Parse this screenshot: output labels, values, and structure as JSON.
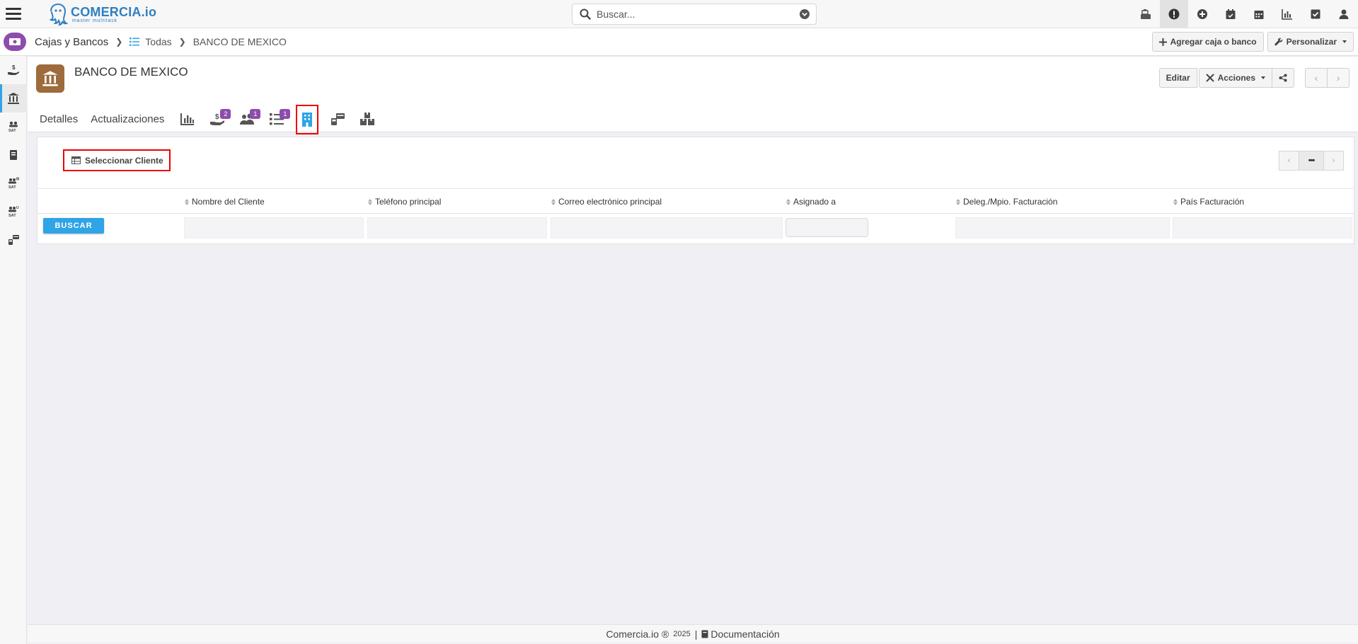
{
  "app": {
    "logo_name": "COMERCIA.io",
    "logo_tagline": "master multitask"
  },
  "search": {
    "placeholder": "Buscar..."
  },
  "top_icons": [
    "cash-register-icon",
    "alert-icon",
    "add-icon",
    "calendar-check-icon",
    "calendar-icon",
    "chart-icon",
    "task-icon",
    "user-icon"
  ],
  "breadcrumb": {
    "root": "Cajas y Bancos",
    "list": "Todas",
    "current": "BANCO DE MEXICO"
  },
  "header_actions": {
    "add_label": "Agregar caja o banco",
    "customize_label": "Personalizar"
  },
  "record": {
    "title": "BANCO DE MEXICO",
    "edit_label": "Editar",
    "actions_label": "Acciones"
  },
  "tabs": {
    "details": "Detalles",
    "updates": "Actualizaciones",
    "payments_badge": "2",
    "contacts_badge": "1",
    "tasks_badge": "1"
  },
  "panel": {
    "select_client_label": "Seleccionar Cliente",
    "pager_more": "•••",
    "columns": [
      "Nombre del Cliente",
      "Teléfono principal",
      "Correo electrónico principal",
      "Asignado a",
      "Deleg./Mpio. Facturación",
      "País Facturación"
    ],
    "search_button": "BUSCAR"
  },
  "footer": {
    "brand": "Comercia.io ®",
    "year": "2025",
    "separator": "|",
    "docs": "Documentación"
  },
  "colors": {
    "accent": "#2fa4e7",
    "badge": "#8e4cad",
    "record_icon": "#9d6b3c",
    "highlight": "#ee0000"
  }
}
